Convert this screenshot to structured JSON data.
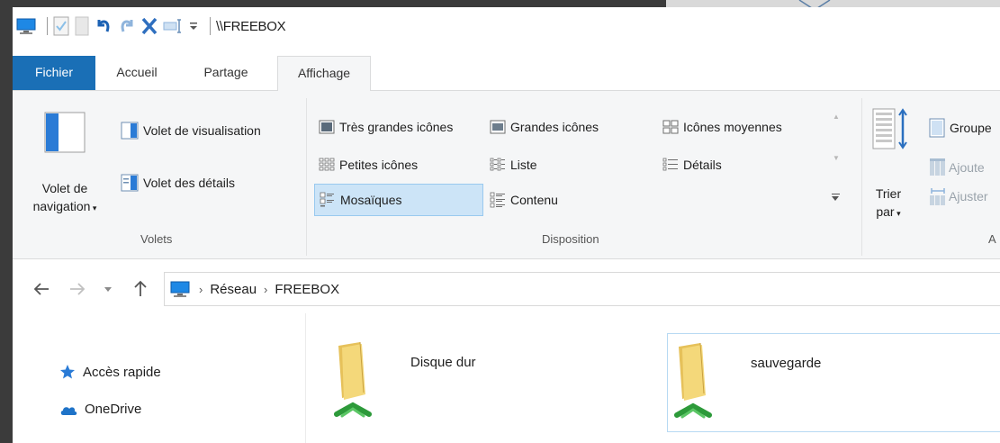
{
  "title_bar": {
    "path": "\\\\FREEBOX"
  },
  "tabs": {
    "file": "Fichier",
    "home": "Accueil",
    "share": "Partage",
    "view": "Affichage"
  },
  "ribbon": {
    "panes": {
      "navigation_pane": "Volet de navigation",
      "navigation_pane_line1": "Volet de",
      "navigation_pane_line2": "navigation",
      "preview_pane": "Volet de visualisation",
      "details_pane": "Volet des détails",
      "group_label": "Volets"
    },
    "layout": {
      "items": [
        "Très grandes icônes",
        "Grandes icônes",
        "Icônes moyennes",
        "Petites icônes",
        "Liste",
        "Détails",
        "Mosaïques",
        "Contenu"
      ],
      "selected": "Mosaïques",
      "group_label": "Disposition"
    },
    "current_view": {
      "sort_by_line1": "Trier",
      "sort_by_line2": "par",
      "group_by": "Groupe",
      "add_columns": "Ajoute",
      "size_columns": "Ajuster",
      "group_label": "A"
    }
  },
  "address": {
    "crumbs": [
      "Réseau",
      "FREEBOX"
    ]
  },
  "nav_pane": {
    "items": [
      "Accès rapide",
      "OneDrive"
    ]
  },
  "folders": [
    {
      "name": "Disque dur"
    },
    {
      "name": "sauvegarde"
    }
  ],
  "colors": {
    "file_tab": "#1a6fb6",
    "selection": "#cce4f7",
    "ribbon_bg": "#f5f6f7"
  }
}
